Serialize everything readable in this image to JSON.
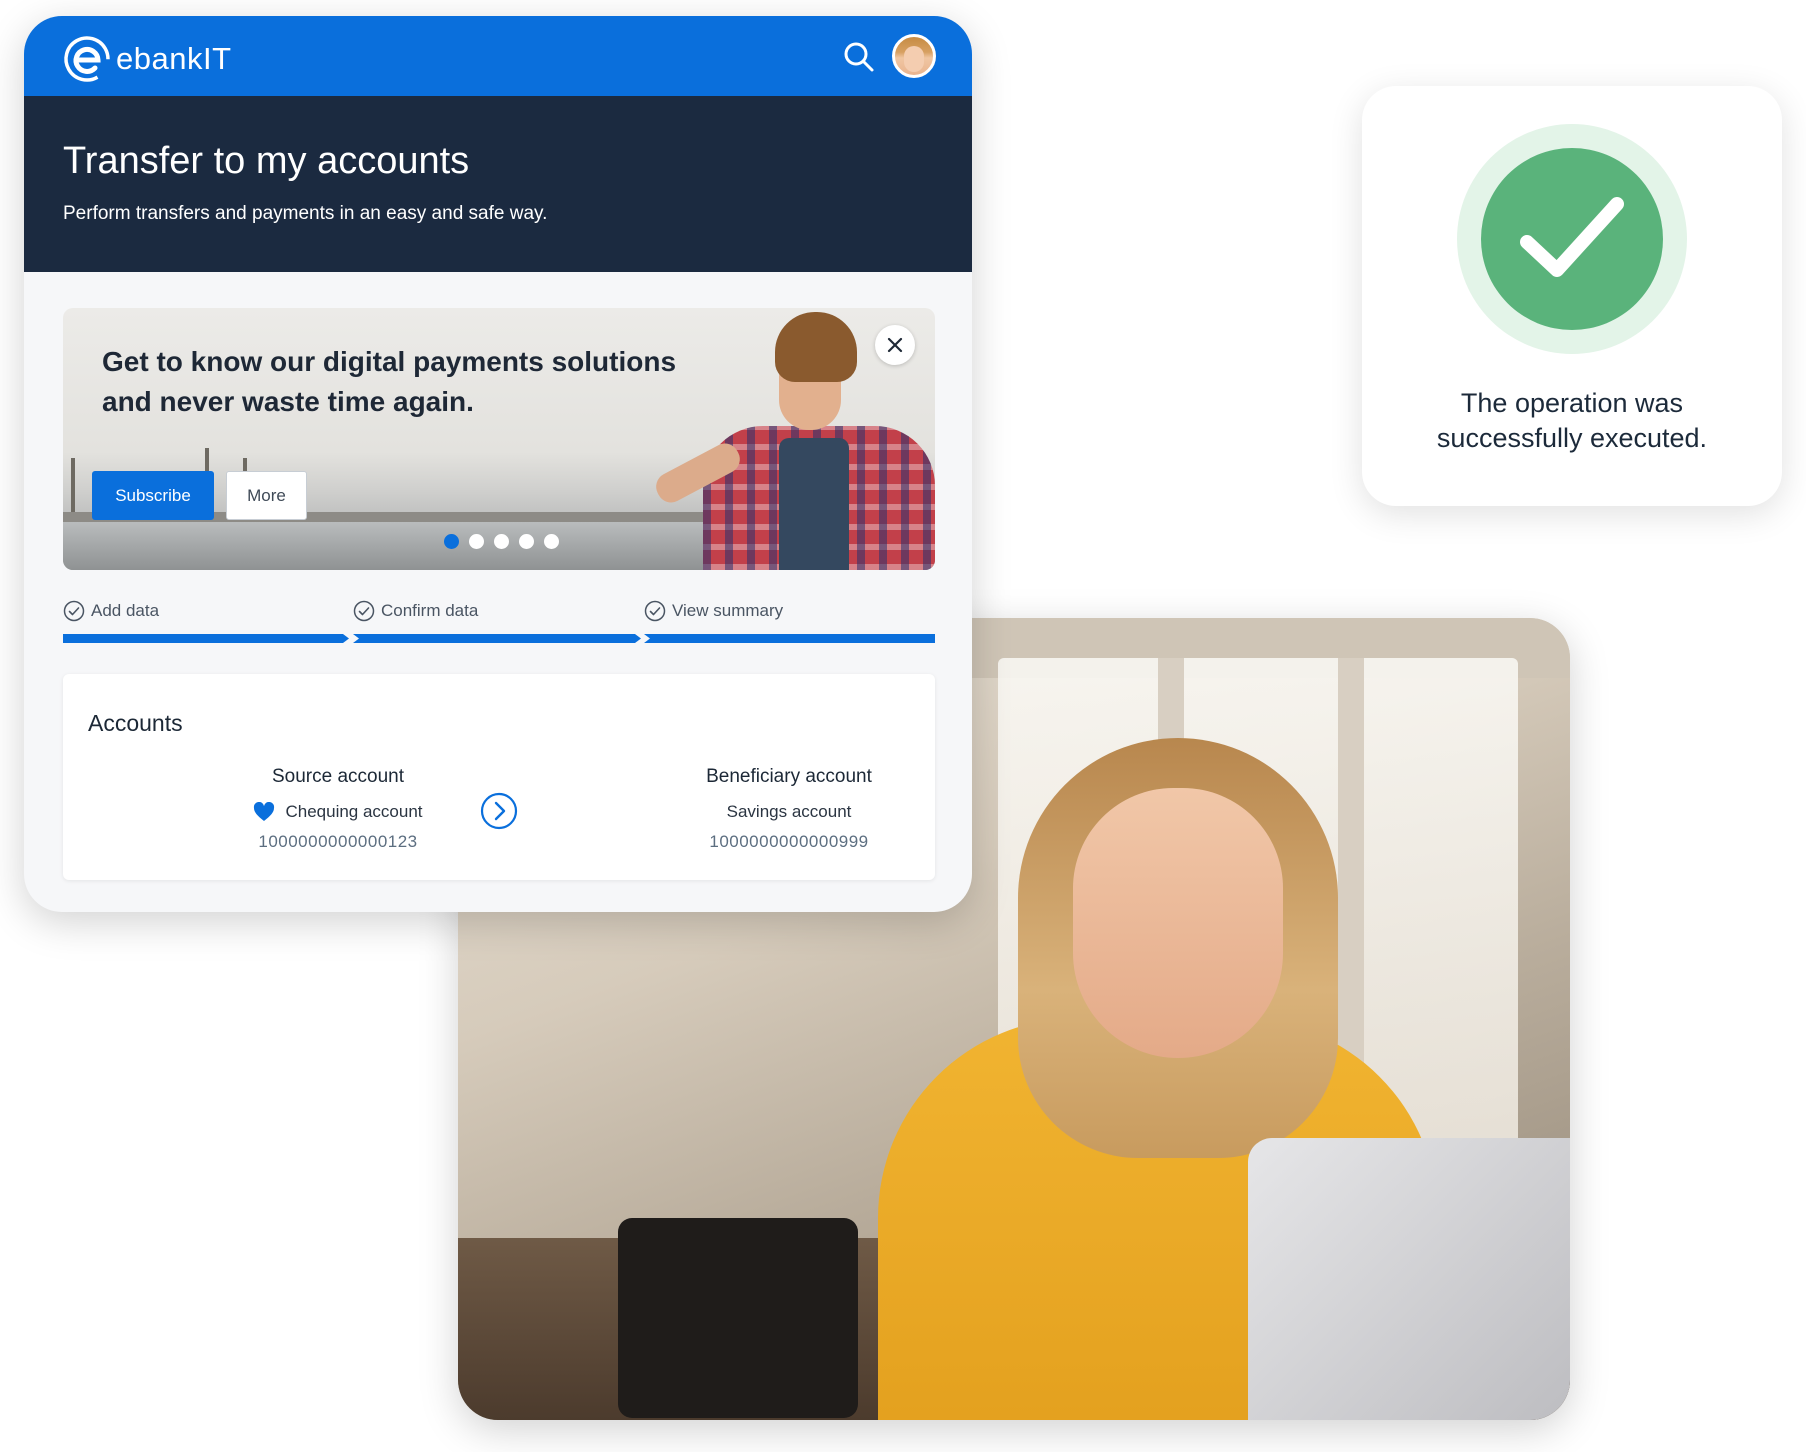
{
  "header": {
    "brand": "ebankIT",
    "search_icon": "search-icon",
    "avatar_icon": "user-avatar"
  },
  "hero": {
    "title": "Transfer to my accounts",
    "subtitle": "Perform transfers and payments in an easy and safe way."
  },
  "banner": {
    "line1": "Get to know our digital payments solutions",
    "line2": "and never waste time again.",
    "subscribe_label": "Subscribe",
    "more_label": "More",
    "slides_total": 5,
    "active_slide": 1
  },
  "stepper": {
    "steps": [
      {
        "label": "Add data"
      },
      {
        "label": "Confirm data"
      },
      {
        "label": "View summary"
      }
    ]
  },
  "accounts": {
    "title": "Accounts",
    "source": {
      "label": "Source account",
      "name": "Chequing account",
      "number": "1000000000000123"
    },
    "beneficiary": {
      "label": "Beneficiary account",
      "name": "Savings account",
      "number": "1000000000000999"
    }
  },
  "success": {
    "line1": "The operation was",
    "line2": "successfully executed."
  },
  "colors": {
    "brand_blue": "#0a6fdc",
    "hero_navy": "#1b2a40",
    "success_green": "#5ab37b"
  }
}
